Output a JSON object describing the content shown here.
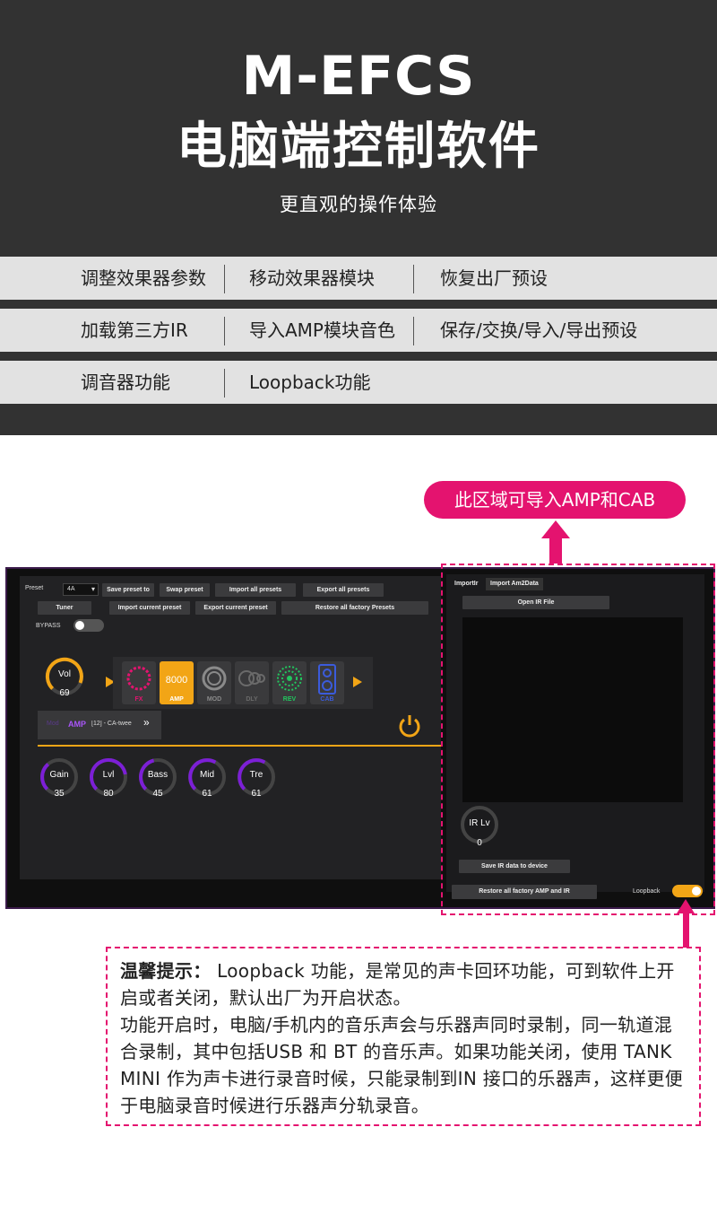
{
  "header": {
    "title": "M-EFCS",
    "subtitle": "电脑端控制软件",
    "tagline": "更直观的操作体验"
  },
  "features": [
    [
      "调整效果器参数",
      "移动效果器模块",
      "恢复出厂预设"
    ],
    [
      "加载第三方IR",
      "导入AMP模块音色",
      "保存/交换/导入/导出预设"
    ],
    [
      "调音器功能",
      "Loopback功能",
      ""
    ]
  ],
  "callout": "此区域可导入AMP和CAB",
  "app": {
    "preset_label": "Preset",
    "preset_value": "4A",
    "buttons_row1": [
      "Save preset to",
      "Swap preset",
      "Import all presets",
      "Export all presets"
    ],
    "buttons_row2": [
      "Tuner",
      "Import current preset",
      "Export current preset",
      "Restore all factory Presets"
    ],
    "bypass_label": "BYPASS",
    "vol": {
      "label": "Vol",
      "value": 69
    },
    "chain": [
      {
        "label": "FX",
        "color": "#e4136f",
        "active": false
      },
      {
        "label": "AMP",
        "color": "#ffffff",
        "active": true
      },
      {
        "label": "MOD",
        "color": "#8a8a8a",
        "active": false
      },
      {
        "label": "DLY",
        "color": "#6a6a6a",
        "active": false
      },
      {
        "label": "REV",
        "color": "#22c55e",
        "active": false
      },
      {
        "label": "CAB",
        "color": "#3b5bdb",
        "active": false
      }
    ],
    "amp_bar": {
      "prefix": "Mod",
      "type": "AMP",
      "name": "[12] - CA-twee"
    },
    "knobs": [
      {
        "label": "Gain",
        "value": 35
      },
      {
        "label": "Lvl",
        "value": 80
      },
      {
        "label": "Bass",
        "value": 45
      },
      {
        "label": "Mid",
        "value": 61
      },
      {
        "label": "Tre",
        "value": 61
      }
    ],
    "right": {
      "tabs": [
        "ImportIr",
        "Import Am2Data"
      ],
      "open_ir": "Open IR File",
      "ir_lv": {
        "label": "IR Lv",
        "value": 0
      },
      "save_ir": "Save IR data to device",
      "restore_ir": "Restore all factory AMP and IR",
      "loopback_label": "Loopback"
    }
  },
  "tip": {
    "head": "温馨提示：",
    "line1": " Loopback 功能，是常见的声卡回环功能，可到软件上开启或者关闭，默认出厂为开启状态。",
    "line2": "功能开启时，电脑/手机内的音乐声会与乐器声同时录制，同一轨道混合录制，其中包括USB 和 BT 的音乐声。如果功能关闭，使用 TANK MINI 作为声卡进行录音时候，只能录制到IN 接口的乐器声，这样更便于电脑录音时候进行乐器声分轨录音。"
  },
  "colors": {
    "accent": "#e4136f",
    "orange": "#f2a516",
    "purple": "#7c1fd6"
  }
}
